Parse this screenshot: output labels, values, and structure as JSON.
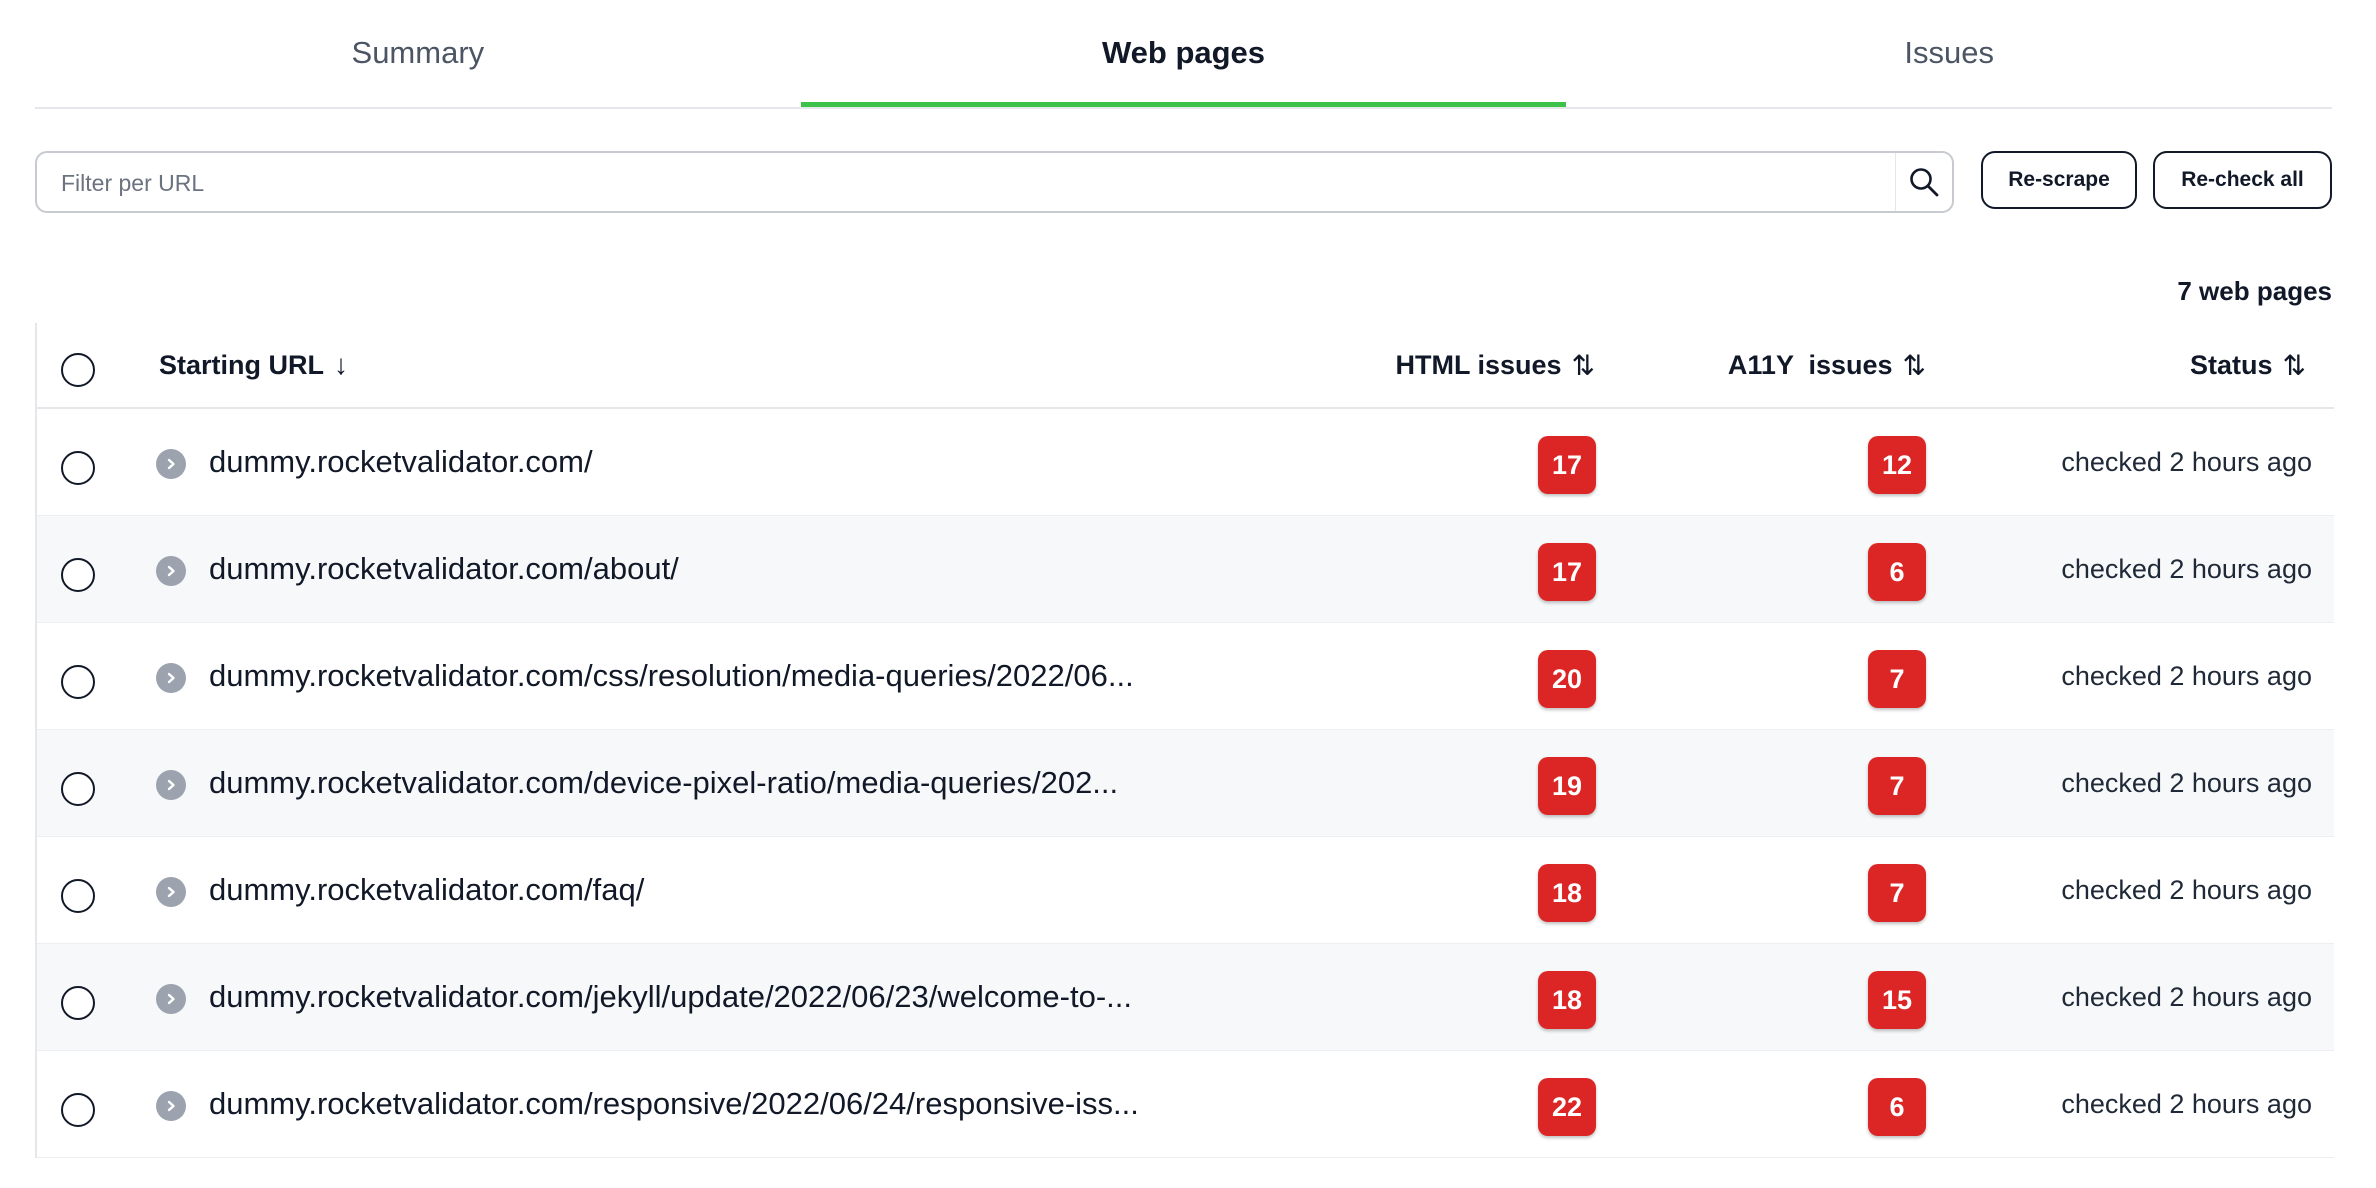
{
  "tabs": [
    {
      "label": "Summary",
      "active": false
    },
    {
      "label": "Web pages",
      "active": true
    },
    {
      "label": "Issues",
      "active": false
    }
  ],
  "filter": {
    "placeholder": "Filter per URL",
    "value": ""
  },
  "buttons": {
    "rescrape": "Re-scrape",
    "recheck_all": "Re-check all"
  },
  "count_label": "7 web pages",
  "table": {
    "headers": {
      "starting_url": "Starting URL",
      "html_issues": "HTML issues",
      "a11y_issues": "A11Y  issues",
      "status": "Status"
    },
    "sort_icons": {
      "starting_url": "↓",
      "html_issues": "⇅",
      "a11y_issues": "⇅",
      "status": "⇅"
    },
    "rows": [
      {
        "url": "dummy.rocketvalidator.com/",
        "html": "17",
        "a11y": "12",
        "status": "checked 2 hours ago"
      },
      {
        "url": "dummy.rocketvalidator.com/about/",
        "html": "17",
        "a11y": "6",
        "status": "checked 2 hours ago"
      },
      {
        "url": "dummy.rocketvalidator.com/css/resolution/media-queries/2022/06...",
        "html": "20",
        "a11y": "7",
        "status": "checked 2 hours ago"
      },
      {
        "url": "dummy.rocketvalidator.com/device-pixel-ratio/media-queries/202...",
        "html": "19",
        "a11y": "7",
        "status": "checked 2 hours ago"
      },
      {
        "url": "dummy.rocketvalidator.com/faq/",
        "html": "18",
        "a11y": "7",
        "status": "checked 2 hours ago"
      },
      {
        "url": "dummy.rocketvalidator.com/jekyll/update/2022/06/23/welcome-to-...",
        "html": "18",
        "a11y": "15",
        "status": "checked 2 hours ago"
      },
      {
        "url": "dummy.rocketvalidator.com/responsive/2022/06/24/responsive-iss...",
        "html": "22",
        "a11y": "6",
        "status": "checked 2 hours ago"
      }
    ]
  },
  "colors": {
    "accent": "#3cc24a",
    "badge": "#dc2626"
  }
}
